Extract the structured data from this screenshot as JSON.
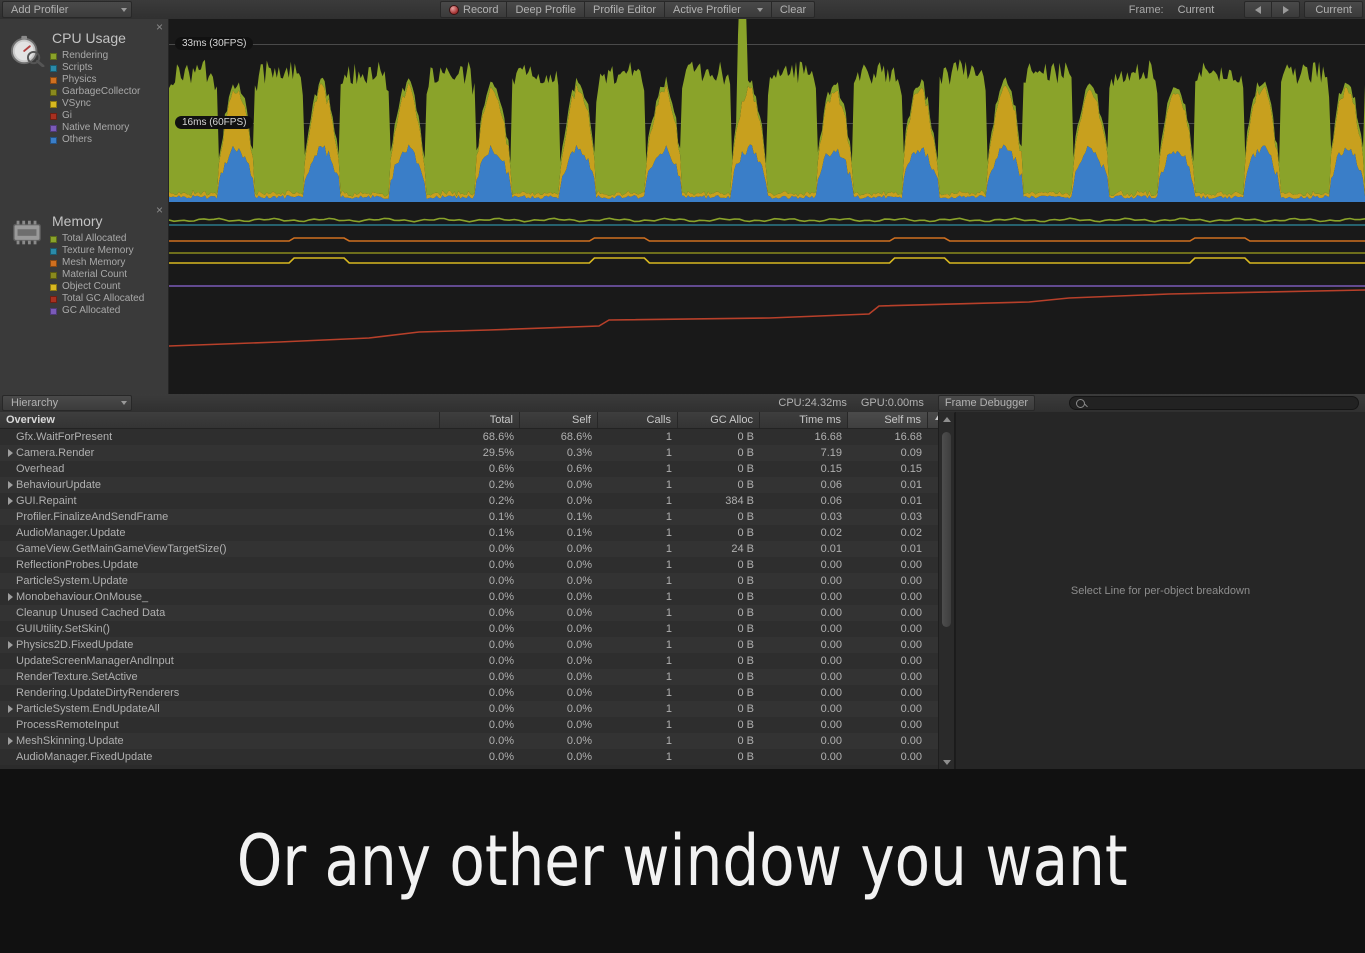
{
  "toolbar": {
    "add_profiler_label": "Add Profiler",
    "record_label": "Record",
    "deep_profile_label": "Deep Profile",
    "profile_editor_label": "Profile Editor",
    "active_profiler_label": "Active Profiler",
    "clear_label": "Clear",
    "frame_label": "Frame:",
    "frame_value": "Current",
    "current_button_label": "Current"
  },
  "cpu_panel": {
    "title": "CPU Usage",
    "close_label": "×",
    "legend": [
      {
        "label": "Rendering",
        "color": "#8aa32a"
      },
      {
        "label": "Scripts",
        "color": "#2a8aa8"
      },
      {
        "label": "Physics",
        "color": "#d07020"
      },
      {
        "label": "GarbageCollector",
        "color": "#8a8a1e"
      },
      {
        "label": "VSync",
        "color": "#d8b820"
      },
      {
        "label": "Gi",
        "color": "#a83020"
      },
      {
        "label": "Native Memory",
        "color": "#7a5ab8"
      },
      {
        "label": "Others",
        "color": "#3a7ec8"
      }
    ],
    "grid_labels": [
      {
        "text": "33ms (30FPS)",
        "y": 38
      },
      {
        "text": "16ms (60FPS)",
        "y": 117
      }
    ]
  },
  "memory_panel": {
    "title": "Memory",
    "close_label": "×",
    "legend": [
      {
        "label": "Total Allocated",
        "color": "#8aa32a"
      },
      {
        "label": "Texture Memory",
        "color": "#2a8aa8"
      },
      {
        "label": "Mesh Memory",
        "color": "#d07020"
      },
      {
        "label": "Material Count",
        "color": "#8a8a1e"
      },
      {
        "label": "Object Count",
        "color": "#d8b820"
      },
      {
        "label": "Total GC Allocated",
        "color": "#a83020"
      },
      {
        "label": "GC Allocated",
        "color": "#7a5ab8"
      }
    ]
  },
  "hierarchy_bar": {
    "view_label": "Hierarchy",
    "cpu_stat": "CPU:24.32ms",
    "gpu_stat": "GPU:0.00ms",
    "frame_debugger_label": "Frame Debugger",
    "search_placeholder": ""
  },
  "table": {
    "columns": [
      "Overview",
      "Total",
      "Self",
      "Calls",
      "GC Alloc",
      "Time ms",
      "Self ms"
    ],
    "sorted_column": "Self ms",
    "sort_direction": "ascending",
    "rows": [
      {
        "name": "Gfx.WaitForPresent",
        "expandable": false,
        "total": "68.6%",
        "self": "68.6%",
        "calls": "1",
        "gc": "0 B",
        "time_ms": "16.68",
        "self_ms": "16.68"
      },
      {
        "name": "Camera.Render",
        "expandable": true,
        "total": "29.5%",
        "self": "0.3%",
        "calls": "1",
        "gc": "0 B",
        "time_ms": "7.19",
        "self_ms": "0.09"
      },
      {
        "name": "Overhead",
        "expandable": false,
        "total": "0.6%",
        "self": "0.6%",
        "calls": "1",
        "gc": "0 B",
        "time_ms": "0.15",
        "self_ms": "0.15"
      },
      {
        "name": "BehaviourUpdate",
        "expandable": true,
        "total": "0.2%",
        "self": "0.0%",
        "calls": "1",
        "gc": "0 B",
        "time_ms": "0.06",
        "self_ms": "0.01"
      },
      {
        "name": "GUI.Repaint",
        "expandable": true,
        "total": "0.2%",
        "self": "0.0%",
        "calls": "1",
        "gc": "384 B",
        "time_ms": "0.06",
        "self_ms": "0.01"
      },
      {
        "name": "Profiler.FinalizeAndSendFrame",
        "expandable": false,
        "total": "0.1%",
        "self": "0.1%",
        "calls": "1",
        "gc": "0 B",
        "time_ms": "0.03",
        "self_ms": "0.03"
      },
      {
        "name": "AudioManager.Update",
        "expandable": false,
        "total": "0.1%",
        "self": "0.1%",
        "calls": "1",
        "gc": "0 B",
        "time_ms": "0.02",
        "self_ms": "0.02"
      },
      {
        "name": "GameView.GetMainGameViewTargetSize()",
        "expandable": false,
        "total": "0.0%",
        "self": "0.0%",
        "calls": "1",
        "gc": "24 B",
        "time_ms": "0.01",
        "self_ms": "0.01"
      },
      {
        "name": "ReflectionProbes.Update",
        "expandable": false,
        "total": "0.0%",
        "self": "0.0%",
        "calls": "1",
        "gc": "0 B",
        "time_ms": "0.00",
        "self_ms": "0.00"
      },
      {
        "name": "ParticleSystem.Update",
        "expandable": false,
        "total": "0.0%",
        "self": "0.0%",
        "calls": "1",
        "gc": "0 B",
        "time_ms": "0.00",
        "self_ms": "0.00"
      },
      {
        "name": "Monobehaviour.OnMouse_",
        "expandable": true,
        "total": "0.0%",
        "self": "0.0%",
        "calls": "1",
        "gc": "0 B",
        "time_ms": "0.00",
        "self_ms": "0.00"
      },
      {
        "name": "Cleanup Unused Cached Data",
        "expandable": false,
        "total": "0.0%",
        "self": "0.0%",
        "calls": "1",
        "gc": "0 B",
        "time_ms": "0.00",
        "self_ms": "0.00"
      },
      {
        "name": "GUIUtility.SetSkin()",
        "expandable": false,
        "total": "0.0%",
        "self": "0.0%",
        "calls": "1",
        "gc": "0 B",
        "time_ms": "0.00",
        "self_ms": "0.00"
      },
      {
        "name": "Physics2D.FixedUpdate",
        "expandable": true,
        "total": "0.0%",
        "self": "0.0%",
        "calls": "1",
        "gc": "0 B",
        "time_ms": "0.00",
        "self_ms": "0.00"
      },
      {
        "name": "UpdateScreenManagerAndInput",
        "expandable": false,
        "total": "0.0%",
        "self": "0.0%",
        "calls": "1",
        "gc": "0 B",
        "time_ms": "0.00",
        "self_ms": "0.00"
      },
      {
        "name": "RenderTexture.SetActive",
        "expandable": false,
        "total": "0.0%",
        "self": "0.0%",
        "calls": "1",
        "gc": "0 B",
        "time_ms": "0.00",
        "self_ms": "0.00"
      },
      {
        "name": "Rendering.UpdateDirtyRenderers",
        "expandable": false,
        "total": "0.0%",
        "self": "0.0%",
        "calls": "1",
        "gc": "0 B",
        "time_ms": "0.00",
        "self_ms": "0.00"
      },
      {
        "name": "ParticleSystem.EndUpdateAll",
        "expandable": true,
        "total": "0.0%",
        "self": "0.0%",
        "calls": "1",
        "gc": "0 B",
        "time_ms": "0.00",
        "self_ms": "0.00"
      },
      {
        "name": "ProcessRemoteInput",
        "expandable": false,
        "total": "0.0%",
        "self": "0.0%",
        "calls": "1",
        "gc": "0 B",
        "time_ms": "0.00",
        "self_ms": "0.00"
      },
      {
        "name": "MeshSkinning.Update",
        "expandable": true,
        "total": "0.0%",
        "self": "0.0%",
        "calls": "1",
        "gc": "0 B",
        "time_ms": "0.00",
        "self_ms": "0.00"
      },
      {
        "name": "AudioManager.FixedUpdate",
        "expandable": false,
        "total": "0.0%",
        "self": "0.0%",
        "calls": "1",
        "gc": "0 B",
        "time_ms": "0.00",
        "self_ms": "0.00"
      }
    ]
  },
  "detail_panel": {
    "placeholder": "Select Line for per-object breakdown"
  },
  "caption": {
    "text": "Or any other window you want"
  },
  "chart_data": [
    {
      "type": "area",
      "title": "CPU Usage",
      "ylabel": "ms",
      "grid_thresholds_ms": [
        33,
        16
      ],
      "tick_labels": [
        "33ms (30FPS)",
        "16ms (60FPS)"
      ],
      "legend_position": "left-pane",
      "series": [
        {
          "name": "Rendering",
          "color": "#8aa32a"
        },
        {
          "name": "Scripts",
          "color": "#2a8aa8"
        },
        {
          "name": "Physics",
          "color": "#d07020"
        },
        {
          "name": "GarbageCollector",
          "color": "#8a8a1e"
        },
        {
          "name": "VSync",
          "color": "#d8b820"
        },
        {
          "name": "Gi",
          "color": "#a83020"
        },
        {
          "name": "Native Memory",
          "color": "#7a5ab8"
        },
        {
          "name": "Others",
          "color": "#3a7ec8"
        }
      ],
      "notes": "Repeating burst pattern of ~14 large green Rendering humps spanning frame history, with blue Others and gold VSync valleys between. One tall narrow spike near 48% of the width exceeds the 33ms line."
    },
    {
      "type": "line",
      "title": "Memory",
      "legend_position": "left-pane",
      "series": [
        {
          "name": "Total Allocated",
          "color": "#8aa32a",
          "shape": "flat-high"
        },
        {
          "name": "Texture Memory",
          "color": "#2a8aa8",
          "shape": "flat-high"
        },
        {
          "name": "Mesh Memory",
          "color": "#d07020",
          "shape": "flat"
        },
        {
          "name": "Material Count",
          "color": "#8a8a1e",
          "shape": "flat"
        },
        {
          "name": "Object Count",
          "color": "#d8b820",
          "shape": "stepped"
        },
        {
          "name": "Total GC Allocated",
          "color": "#a83020",
          "shape": "rising-ramp"
        },
        {
          "name": "GC Allocated",
          "color": "#7a5ab8",
          "shape": "flat"
        }
      ],
      "notes": "Six near-flat lines clustered in the upper region; the red Total GC Allocated line rises gradually from lower-left to mid-right."
    }
  ]
}
